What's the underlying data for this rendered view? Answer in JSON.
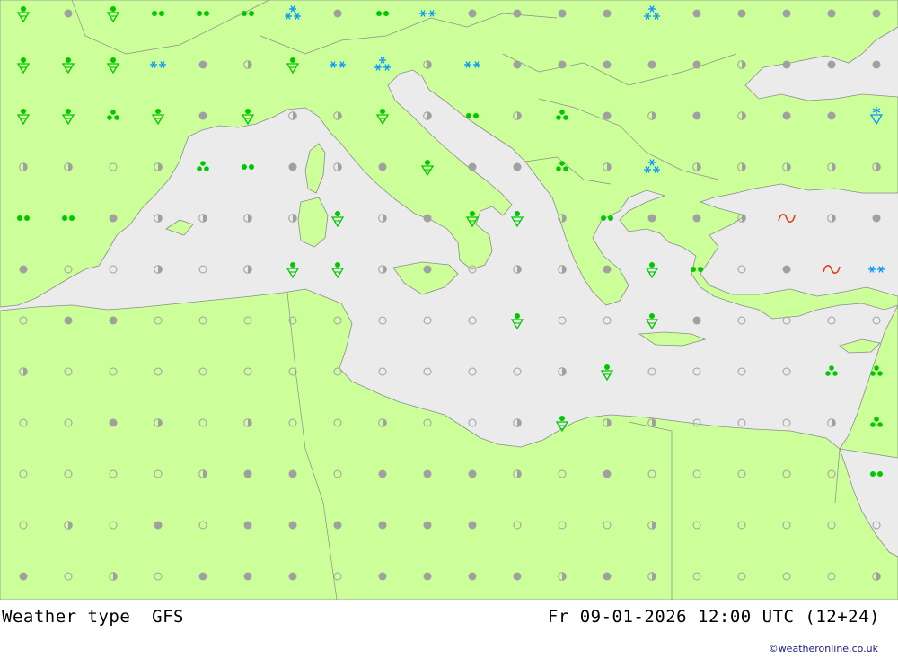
{
  "caption": {
    "title": "Weather type  GFS",
    "datetime": "Fr 09-01-2026 12:00 UTC (12+24)"
  },
  "credit": "©weatheronline.co.uk",
  "colors": {
    "land": "#ccff99",
    "sea": "#ebebeb",
    "border": "#8c8c8c",
    "no_weather": "#a0a0a0",
    "rain": "#00c800",
    "snow": "#0096ff",
    "fog": "#e03c1e"
  },
  "symbol_legend": {
    "C": "cloudy-dot",
    "H": "half-cloudy-circle",
    "O": "clear-circle",
    "D": "drizzle-dots",
    "R": "rain-shower",
    "T": "heavy-rain-triangle-dots",
    "S": "snow-stars",
    "W": "snow-flurries",
    "X": "snow-shower",
    "F": "fog-tilde"
  },
  "weather_grid": [
    "RCRDDDSCDWCCCCSCCCCC",
    "RRRWCHRWSHWCCCCCHCCC",
    "RRTRCRHHRHDHTCHCHCCX",
    "HHOHTDCHCRCCTHSHHHHH",
    "DDCHHHHRHCRRHDCCHFHC",
    "COOHOHRRHCOHHCRDOCFW",
    "OCCOOOOOOOOROORCOOOO",
    "HOOOOOOOOOOOHROOOOTT",
    "OOCHOHOOHOOHRHHOOOHT",
    "OOOOHCCOCCCHOCOOOOOD",
    "OHOCOCCCCCCOOOHOOOOO",
    "COHOCCCOCCCCHCHOOOOH"
  ]
}
